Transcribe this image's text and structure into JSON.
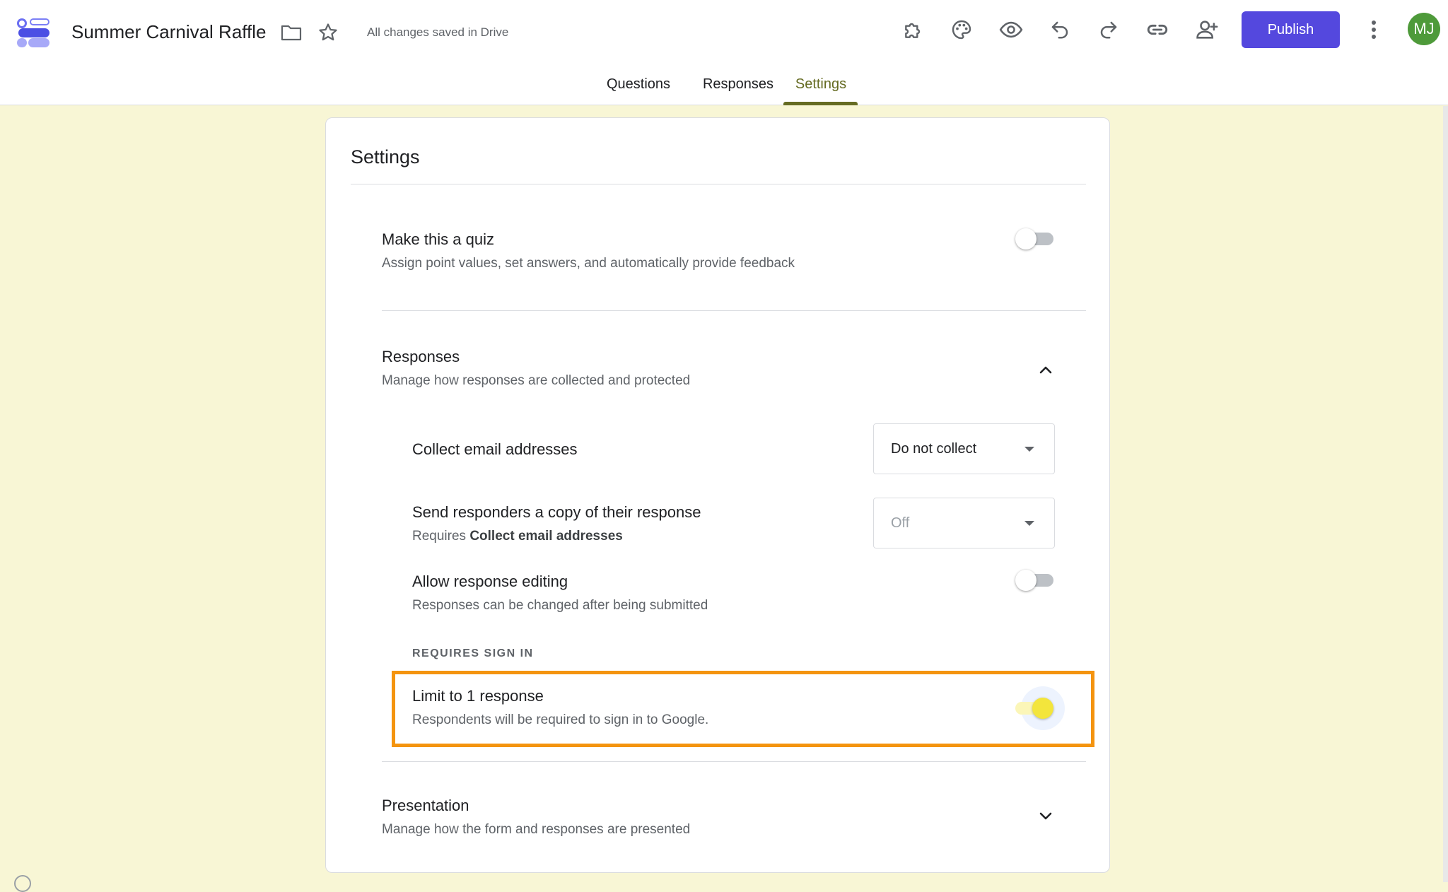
{
  "header": {
    "app_icon": "forms-logo-icon",
    "title": "Summer Carnival Raffle",
    "saved_status": "All changes saved in Drive",
    "publish_label": "Publish",
    "avatar_initials": "MJ",
    "brand_color": "#5448de"
  },
  "tabs": [
    {
      "label": "Questions",
      "active": false
    },
    {
      "label": "Responses",
      "active": false
    },
    {
      "label": "Settings",
      "active": true
    }
  ],
  "settings": {
    "title": "Settings",
    "quiz": {
      "title": "Make this a quiz",
      "subtitle": "Assign point values, set answers, and automatically provide feedback",
      "enabled": false
    },
    "responses": {
      "title": "Responses",
      "subtitle": "Manage how responses are collected and protected",
      "expanded": true,
      "collect_email": {
        "label": "Collect email addresses",
        "value": "Do not collect"
      },
      "send_copy": {
        "label": "Send responders a copy of their response",
        "sub_prefix": "Requires ",
        "sub_bold": "Collect email addresses",
        "value": "Off",
        "disabled": true
      },
      "allow_editing": {
        "label": "Allow response editing",
        "subtitle": "Responses can be changed after being submitted",
        "enabled": false
      },
      "requires_sign_in_label": "REQUIRES SIGN IN",
      "limit_one": {
        "label": "Limit to 1 response",
        "subtitle": "Respondents will be required to sign in to Google.",
        "enabled": true
      }
    },
    "presentation": {
      "title": "Presentation",
      "subtitle": "Manage how the form and responses are presented",
      "expanded": false
    }
  }
}
